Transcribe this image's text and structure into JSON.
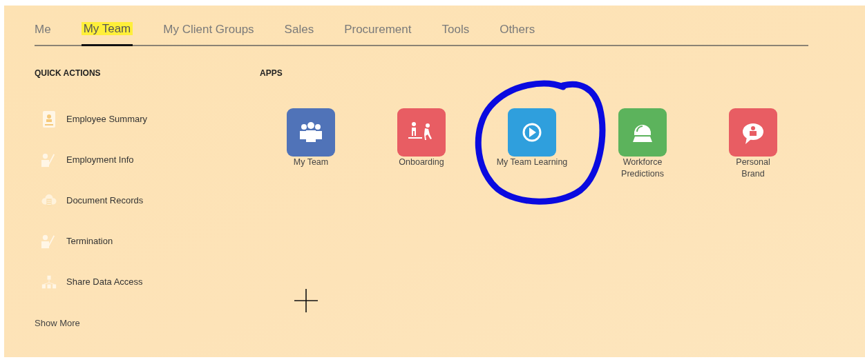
{
  "tabs": [
    {
      "label": "Me",
      "selected": false,
      "highlighted": false
    },
    {
      "label": "My Team",
      "selected": true,
      "highlighted": true
    },
    {
      "label": "My Client Groups",
      "selected": false,
      "highlighted": false
    },
    {
      "label": "Sales",
      "selected": false,
      "highlighted": false
    },
    {
      "label": "Procurement",
      "selected": false,
      "highlighted": false
    },
    {
      "label": "Tools",
      "selected": false,
      "highlighted": false
    },
    {
      "label": "Others",
      "selected": false,
      "highlighted": false
    }
  ],
  "quick_actions": {
    "title": "QUICK ACTIONS",
    "items": [
      {
        "label": "Employee Summary",
        "kind": "badge"
      },
      {
        "label": "Employment Info",
        "kind": "person"
      },
      {
        "label": "Document Records",
        "kind": "cloud"
      },
      {
        "label": "Termination",
        "kind": "person"
      },
      {
        "label": "Share Data Access",
        "kind": "hierarchy"
      }
    ],
    "show_more": "Show More"
  },
  "apps": {
    "title": "APPS",
    "items": [
      {
        "label": "My Team",
        "kind": "team",
        "color": "#5073b8",
        "circled": false
      },
      {
        "label": "Onboarding",
        "kind": "onboard",
        "color": "#e85d63",
        "circled": false
      },
      {
        "label": "My Team Learning",
        "kind": "play",
        "color": "#2f9fdd",
        "circled": true
      },
      {
        "label": "Workforce Predictions",
        "kind": "globe",
        "color": "#5cb35c",
        "circled": false
      },
      {
        "label": "Personal Brand",
        "kind": "speech",
        "color": "#e85d63",
        "circled": false
      }
    ]
  }
}
